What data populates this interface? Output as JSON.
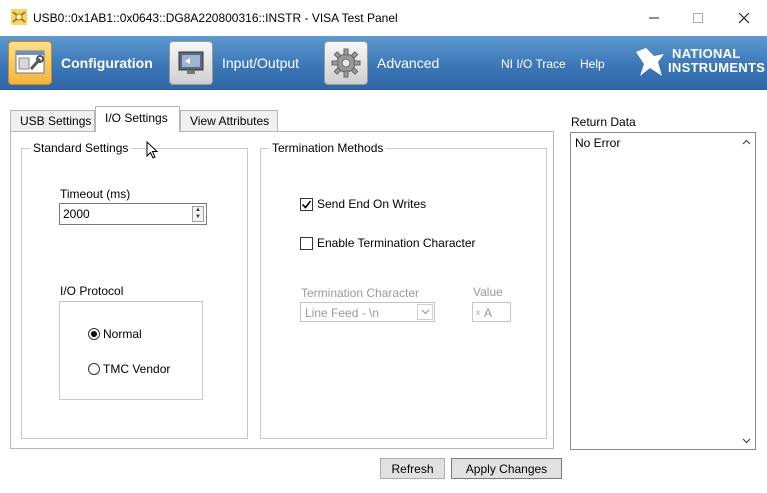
{
  "window": {
    "title": "USB0::0x1AB1::0x0643::DG8A220800316::INSTR - VISA Test Panel",
    "icon": "visa-test-panel-icon",
    "controls": [
      "minimize",
      "maximize",
      "close"
    ]
  },
  "toolbar": {
    "items": [
      {
        "label": "Configuration",
        "icon": "configuration-icon",
        "active": true
      },
      {
        "label": "Input/Output",
        "icon": "input-output-icon",
        "active": false
      },
      {
        "label": "Advanced",
        "icon": "advanced-gear-icon",
        "active": false
      }
    ],
    "links": [
      "NI I/O Trace",
      "Help"
    ],
    "logo": {
      "line1": "NATIONAL",
      "line2": "INSTRUMENTS"
    },
    "colors": {
      "bar": "#3d77b7",
      "active_icon": "#f2b43c"
    }
  },
  "tabs": [
    {
      "label": "USB Settings",
      "active": false
    },
    {
      "label": "I/O Settings",
      "active": true
    },
    {
      "label": "View Attributes",
      "active": false
    }
  ],
  "standard_settings": {
    "title": "Standard Settings",
    "timeout_label": "Timeout (ms)",
    "timeout_value": "2000",
    "io_protocol_label": "I/O Protocol",
    "protocols": [
      {
        "label": "Normal",
        "selected": true
      },
      {
        "label": "TMC Vendor",
        "selected": false
      }
    ]
  },
  "termination": {
    "title": "Termination Methods",
    "send_end_label": "Send End On Writes",
    "send_end_checked": true,
    "enable_term_label": "Enable Termination Character",
    "enable_term_checked": false,
    "term_char_label": "Termination Character",
    "term_char_value": "Line Feed - \\n",
    "value_label": "Value",
    "value_prefix": "x",
    "value_value": "A"
  },
  "return_data": {
    "label": "Return Data",
    "text": "No Error"
  },
  "buttons": {
    "refresh": "Refresh",
    "apply": "Apply Changes"
  }
}
